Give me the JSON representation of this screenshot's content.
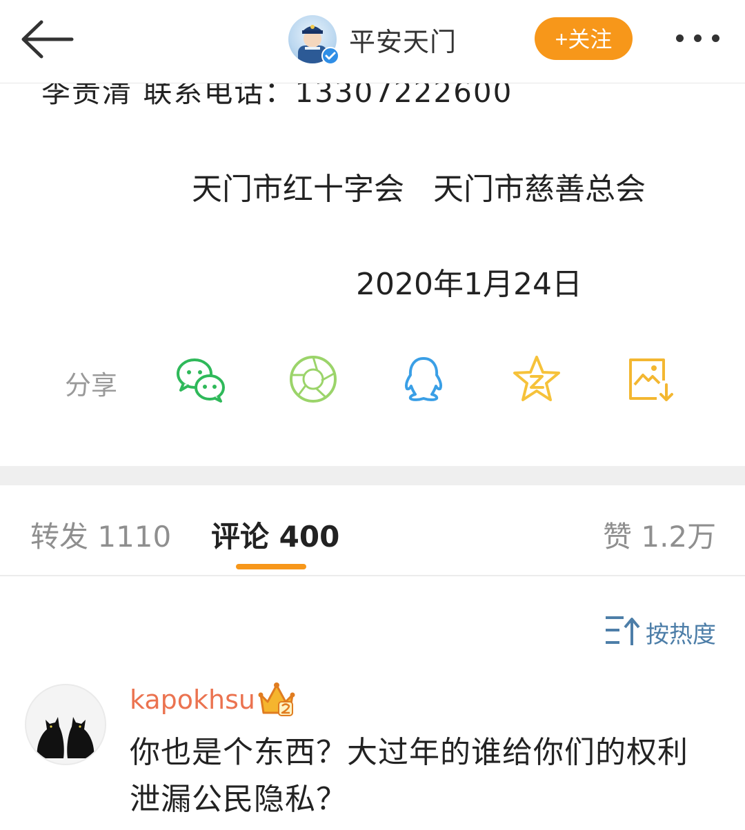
{
  "header": {
    "back_icon": "arrow-left-icon",
    "account_name": "平安天门",
    "follow_label": "+关注",
    "more_icon": "more-dots-icon"
  },
  "post": {
    "cut_line": "李贵清 联系电话：13307222600",
    "organizations": "天门市红十字会 天门市慈善总会",
    "date": "2020年1月24日"
  },
  "share": {
    "label": "分享",
    "targets": [
      "wechat-icon",
      "moments-icon",
      "qq-icon",
      "qzone-icon",
      "save-image-icon"
    ]
  },
  "tabs": {
    "repost": "转发 1110",
    "comments": "评论 400",
    "likes": "赞 1.2万"
  },
  "sort": {
    "label": "按热度",
    "icon": "sort-hot-icon"
  },
  "comments": [
    {
      "username": "kapokhsu",
      "badge": "vip-crown-icon",
      "text": "你也是个东西？大过年的谁给你们的权利泄漏公民隐私？"
    }
  ],
  "colors": {
    "accent_orange": "#f7971a",
    "username_orange": "#eb7350",
    "link_blue": "#4d7ea8",
    "wechat_green": "#2fb95a",
    "moments_green": "#9bd46a",
    "qq_blue": "#3a9fe6",
    "qzone_yellow": "#f6c23a",
    "save_yellow": "#f3b731"
  }
}
